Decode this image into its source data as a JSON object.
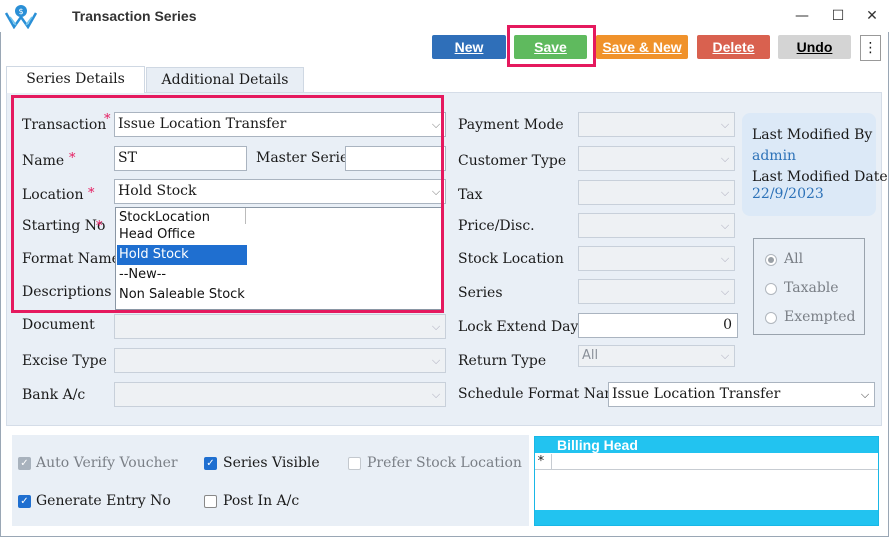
{
  "window": {
    "title": "Transaction Series",
    "minimize": "—",
    "maximize": "☐",
    "close": "✕"
  },
  "toolbar": {
    "new_label": "New",
    "save_label": "Save",
    "save_new_label": "Save & New",
    "delete_label": "Delete",
    "undo_label": "Undo",
    "more_label": "⋮"
  },
  "tabs": [
    {
      "label": "Series Details"
    },
    {
      "label": "Additional Details"
    }
  ],
  "form": {
    "transaction": {
      "label": "Transaction",
      "value": "Issue Location Transfer",
      "required": "*"
    },
    "name": {
      "label": "Name",
      "value": "ST",
      "required": "*"
    },
    "master_series": {
      "label": "Master Series",
      "value": ""
    },
    "location": {
      "label": "Location",
      "value": "Hold Stock",
      "required": "*"
    },
    "starting_no": {
      "label": "Starting No",
      "required": "*"
    },
    "format_name": {
      "label": "Format Name"
    },
    "descriptions": {
      "label": "Descriptions"
    },
    "document": {
      "label": "Document"
    },
    "excise_type": {
      "label": "Excise Type"
    },
    "bank_ac": {
      "label": "Bank A/c"
    }
  },
  "location_dropdown": {
    "options": [
      "StockLocation",
      "Head Office",
      "Hold Stock",
      "--New--",
      "Non Saleable Stock"
    ],
    "selected": "Hold Stock"
  },
  "right_form": {
    "payment_mode": {
      "label": "Payment Mode"
    },
    "customer_type": {
      "label": "Customer Type"
    },
    "tax": {
      "label": "Tax"
    },
    "price_disc": {
      "label": "Price/Disc."
    },
    "stock_location": {
      "label": "Stock Location"
    },
    "series": {
      "label": "Series"
    },
    "lock_extend_days": {
      "label": "Lock Extend Days",
      "value": "0"
    },
    "return_type": {
      "label": "Return Type",
      "value": "All"
    },
    "schedule_format_name": {
      "label": "Schedule Format Name",
      "value": "Issue Location Transfer"
    }
  },
  "info_card": {
    "last_modified_by_label": "Last Modified By",
    "last_modified_by": "admin",
    "last_modified_date_label": "Last Modified Date",
    "last_modified_date": "22/9/2023"
  },
  "tax_filter": {
    "options": [
      "All",
      "Taxable",
      "Exempted"
    ],
    "selected": "All"
  },
  "checkboxes": {
    "auto_verify_voucher": {
      "label": "Auto Verify Voucher",
      "checked": true,
      "disabled": true
    },
    "series_visible": {
      "label": "Series Visible",
      "checked": true
    },
    "prefer_stock_location": {
      "label": "Prefer Stock Location",
      "checked": false,
      "disabled": true
    },
    "generate_entry_no": {
      "label": "Generate Entry No",
      "checked": true
    },
    "post_in_ac": {
      "label": "Post In A/c",
      "checked": false
    }
  },
  "billing_grid": {
    "header": "Billing Head",
    "new_row_marker": "*"
  },
  "icons": {
    "chevron": "⌵",
    "check": "✓"
  },
  "colors": {
    "new_button": "#2f6fb9",
    "save_button": "#5fba5e",
    "save_new_button": "#f0922b",
    "delete_button": "#d9614f",
    "highlight": "#e5195e",
    "grid_header": "#22c3f0",
    "selection": "#1f6fd0"
  }
}
